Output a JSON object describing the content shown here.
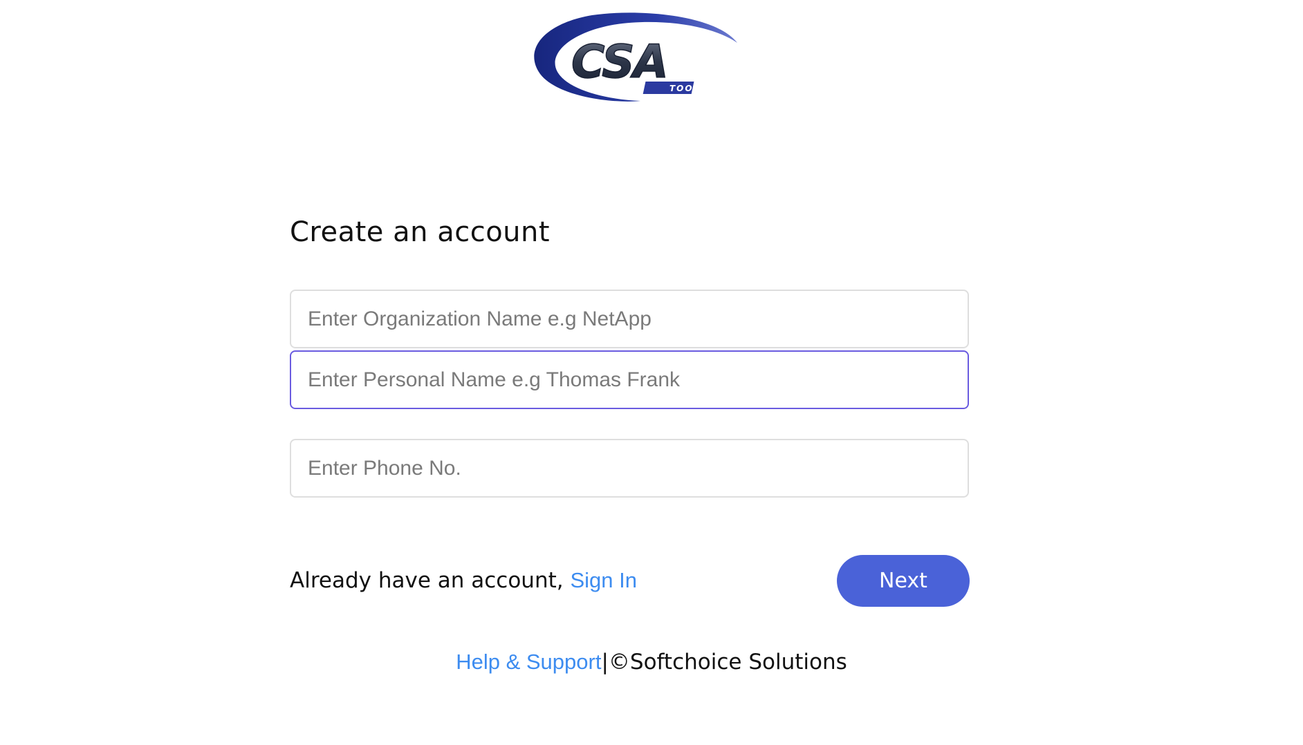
{
  "logo": {
    "text": "CSA",
    "subtext": "TOOL",
    "icon": "csa-tool-logo",
    "colors": {
      "swoosh": "#1f2f8f",
      "letters": "#2a3550",
      "badge": "#2b3aa0"
    }
  },
  "form": {
    "title": "Create an account",
    "organization_placeholder": "Enter Organization Name e.g NetApp",
    "organization_value": "",
    "personal_name_placeholder": "Enter Personal Name e.g Thomas Frank",
    "personal_name_value": "",
    "phone_placeholder": "Enter Phone No.",
    "phone_value": ""
  },
  "signin": {
    "prompt": "Already have an account, ",
    "link_label": "Sign In"
  },
  "actions": {
    "next_label": "Next"
  },
  "footer": {
    "help_label": "Help & Support",
    "separator": "|",
    "copyright": "©Softchoice Solutions"
  },
  "colors": {
    "accent": "#4a62d8",
    "link": "#3d8cf0",
    "focus_border": "#6a5be0",
    "field_border": "#dedede"
  }
}
